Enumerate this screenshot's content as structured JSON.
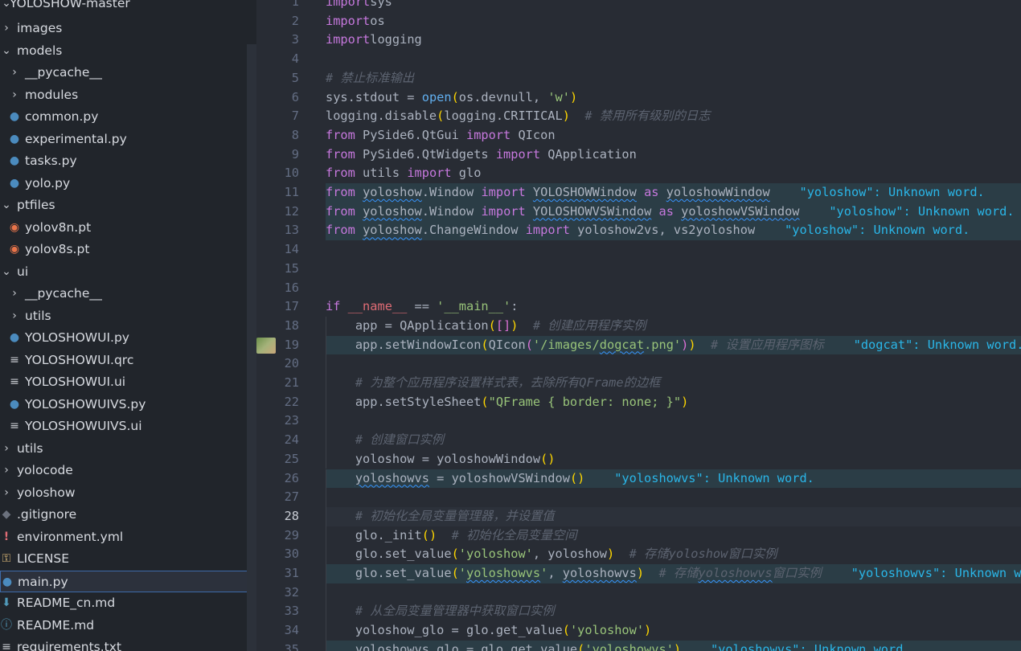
{
  "explorer": {
    "root": "YOLOSHOW-master",
    "items": [
      {
        "label": "images",
        "type": "folder",
        "open": false,
        "depth": 0
      },
      {
        "label": "models",
        "type": "folder",
        "open": true,
        "depth": 0
      },
      {
        "label": "__pycache__",
        "type": "folder",
        "open": false,
        "depth": 1
      },
      {
        "label": "modules",
        "type": "folder",
        "open": false,
        "depth": 1
      },
      {
        "label": "common.py",
        "type": "python",
        "depth": 1
      },
      {
        "label": "experimental.py",
        "type": "python",
        "depth": 1
      },
      {
        "label": "tasks.py",
        "type": "python",
        "depth": 1
      },
      {
        "label": "yolo.py",
        "type": "python",
        "depth": 1
      },
      {
        "label": "ptfiles",
        "type": "folder",
        "open": true,
        "depth": 0
      },
      {
        "label": "yolov8n.pt",
        "type": "rss",
        "depth": 1
      },
      {
        "label": "yolov8s.pt",
        "type": "rss",
        "depth": 1
      },
      {
        "label": "ui",
        "type": "folder",
        "open": true,
        "depth": 0
      },
      {
        "label": "__pycache__",
        "type": "folder",
        "open": false,
        "depth": 1
      },
      {
        "label": "utils",
        "type": "folder",
        "open": false,
        "depth": 1
      },
      {
        "label": "YOLOSHOWUI.py",
        "type": "python",
        "depth": 1
      },
      {
        "label": "YOLOSHOWUI.qrc",
        "type": "text",
        "depth": 1
      },
      {
        "label": "YOLOSHOWUI.ui",
        "type": "text",
        "depth": 1
      },
      {
        "label": "YOLOSHOWUIVS.py",
        "type": "python",
        "depth": 1
      },
      {
        "label": "YOLOSHOWUIVS.ui",
        "type": "text",
        "depth": 1
      },
      {
        "label": "utils",
        "type": "folder",
        "open": false,
        "depth": 0
      },
      {
        "label": "yolocode",
        "type": "folder",
        "open": false,
        "depth": 0
      },
      {
        "label": "yoloshow",
        "type": "folder",
        "open": false,
        "depth": 0
      },
      {
        "label": ".gitignore",
        "type": "git",
        "depth": 0
      },
      {
        "label": "environment.yml",
        "type": "warn",
        "depth": 0
      },
      {
        "label": "LICENSE",
        "type": "license",
        "depth": 0
      },
      {
        "label": "main.py",
        "type": "python",
        "depth": 0,
        "selected": true
      },
      {
        "label": "README_cn.md",
        "type": "md",
        "depth": 0
      },
      {
        "label": "README.md",
        "type": "info",
        "depth": 0
      },
      {
        "label": "requirements.txt",
        "type": "text",
        "depth": 0
      }
    ]
  },
  "editor": {
    "current_line": 28,
    "lines": [
      {
        "n": "1",
        "segs": [
          [
            "k",
            "import"
          ],
          [
            "",
            "sys"
          ]
        ]
      },
      {
        "n": "2",
        "segs": [
          [
            "k",
            "import"
          ],
          [
            "",
            "os"
          ]
        ]
      },
      {
        "n": "3",
        "segs": [
          [
            "k",
            "import"
          ],
          [
            "",
            "logging"
          ]
        ]
      },
      {
        "n": "4",
        "segs": []
      },
      {
        "n": "5",
        "segs": [
          [
            "c",
            "# 禁止标准输出"
          ]
        ]
      },
      {
        "n": "6",
        "segs": [
          [
            "",
            "sys.stdout = "
          ],
          [
            "f",
            "open"
          ],
          [
            "bk1",
            "("
          ],
          [
            "",
            "os.devnull, "
          ],
          [
            "s",
            "'w'"
          ],
          [
            "bk1",
            ")"
          ]
        ]
      },
      {
        "n": "7",
        "segs": [
          [
            "",
            "logging.disable"
          ],
          [
            "bk1",
            "("
          ],
          [
            "",
            "logging.CRITICAL"
          ],
          [
            "bk1",
            ")"
          ],
          [
            "",
            " "
          ],
          [
            "c",
            " # 禁用所有级别的日志"
          ]
        ]
      },
      {
        "n": "8",
        "segs": [
          [
            "k",
            "from"
          ],
          [
            "",
            " PySide6.QtGui "
          ],
          [
            "k",
            "import"
          ],
          [
            "",
            " QIcon"
          ]
        ]
      },
      {
        "n": "9",
        "segs": [
          [
            "k",
            "from"
          ],
          [
            "",
            " PySide6.QtWidgets "
          ],
          [
            "k",
            "import"
          ],
          [
            "",
            " QApplication"
          ]
        ]
      },
      {
        "n": "10",
        "segs": [
          [
            "k",
            "from"
          ],
          [
            "",
            " utils "
          ],
          [
            "k",
            "import"
          ],
          [
            "",
            " glo"
          ]
        ]
      },
      {
        "n": "11",
        "hl": true,
        "segs": [
          [
            "k",
            "from"
          ],
          [
            "",
            " "
          ],
          [
            "w",
            "yoloshow"
          ],
          [
            "",
            ".Window "
          ],
          [
            "k",
            "import"
          ],
          [
            "",
            " "
          ],
          [
            "w",
            "YOLOSHOWWindow"
          ],
          [
            "",
            " "
          ],
          [
            "k",
            "as"
          ],
          [
            "",
            " "
          ],
          [
            "w",
            "yoloshowWindow"
          ],
          [
            "",
            "    "
          ],
          [
            "diag",
            "\"yoloshow\": Unknown word."
          ]
        ]
      },
      {
        "n": "12",
        "hl": true,
        "segs": [
          [
            "k",
            "from"
          ],
          [
            "",
            " "
          ],
          [
            "w",
            "yoloshow"
          ],
          [
            "",
            ".Window "
          ],
          [
            "k",
            "import"
          ],
          [
            "",
            " "
          ],
          [
            "w",
            "YOLOSHOWVSWindow"
          ],
          [
            "",
            " "
          ],
          [
            "k",
            "as"
          ],
          [
            "",
            " "
          ],
          [
            "w",
            "yoloshowVSWindow"
          ],
          [
            "",
            "    "
          ],
          [
            "diag",
            "\"yoloshow\": Unknown word."
          ]
        ]
      },
      {
        "n": "13",
        "hl": true,
        "segs": [
          [
            "k",
            "from"
          ],
          [
            "",
            " "
          ],
          [
            "w",
            "yoloshow"
          ],
          [
            "",
            ".ChangeWindow "
          ],
          [
            "k",
            "import"
          ],
          [
            "",
            " yoloshow2vs, vs2yoloshow"
          ],
          [
            "",
            "    "
          ],
          [
            "diag",
            "\"yoloshow\": Unknown word."
          ]
        ]
      },
      {
        "n": "14",
        "segs": []
      },
      {
        "n": "15",
        "segs": []
      },
      {
        "n": "16",
        "segs": []
      },
      {
        "n": "17",
        "segs": [
          [
            "k",
            "if"
          ],
          [
            "",
            " "
          ],
          [
            "d",
            "__name__"
          ],
          [
            "",
            " == "
          ],
          [
            "s",
            "'__main__'"
          ],
          [
            "",
            ":"
          ]
        ]
      },
      {
        "n": "18",
        "ind": true,
        "segs": [
          [
            "",
            "    app = QApplication"
          ],
          [
            "bk1",
            "("
          ],
          [
            "bk2",
            "[]"
          ],
          [
            "bk1",
            ")"
          ],
          [
            "",
            "  "
          ],
          [
            "c",
            "# 创建应用程序实例"
          ]
        ]
      },
      {
        "n": "19",
        "ind": true,
        "hl": true,
        "glyph": true,
        "segs": [
          [
            "",
            "    app.setWindowIcon"
          ],
          [
            "bk1",
            "("
          ],
          [
            "",
            "QIcon"
          ],
          [
            "bk2",
            "("
          ],
          [
            "s",
            "'/images/"
          ],
          [
            "sw",
            "dogcat"
          ],
          [
            "s",
            ".png'"
          ],
          [
            "bk2",
            ")"
          ],
          [
            "bk1",
            ")"
          ],
          [
            "",
            "  "
          ],
          [
            "c",
            "# 设置应用程序图标"
          ],
          [
            "",
            "    "
          ],
          [
            "diag",
            "\"dogcat\": Unknown word."
          ]
        ]
      },
      {
        "n": "20",
        "ind": true,
        "segs": []
      },
      {
        "n": "21",
        "ind": true,
        "segs": [
          [
            "",
            "    "
          ],
          [
            "c",
            "# 为整个应用程序设置样式表，去除所有QFrame的边框"
          ]
        ]
      },
      {
        "n": "22",
        "ind": true,
        "segs": [
          [
            "",
            "    app.setStyleSheet"
          ],
          [
            "bk1",
            "("
          ],
          [
            "s",
            "\"QFrame { border: none; }\""
          ],
          [
            "bk1",
            ")"
          ]
        ]
      },
      {
        "n": "23",
        "ind": true,
        "segs": []
      },
      {
        "n": "24",
        "ind": true,
        "segs": [
          [
            "",
            "    "
          ],
          [
            "c",
            "# 创建窗口实例"
          ]
        ]
      },
      {
        "n": "25",
        "ind": true,
        "segs": [
          [
            "",
            "    yoloshow = yoloshowWindow"
          ],
          [
            "bk1",
            "()"
          ]
        ]
      },
      {
        "n": "26",
        "ind": true,
        "hl": true,
        "segs": [
          [
            "",
            "    "
          ],
          [
            "w",
            "yoloshowvs"
          ],
          [
            "",
            " = yoloshowVSWindow"
          ],
          [
            "bk1",
            "()"
          ],
          [
            "",
            "    "
          ],
          [
            "diag",
            "\"yoloshowvs\": Unknown word."
          ]
        ]
      },
      {
        "n": "27",
        "ind": true,
        "segs": []
      },
      {
        "n": "28",
        "ind": true,
        "cur": true,
        "segs": [
          [
            "",
            "    "
          ],
          [
            "c",
            "# 初始化全局变量管理器，并设置值"
          ]
        ]
      },
      {
        "n": "29",
        "ind": true,
        "segs": [
          [
            "",
            "    glo._init"
          ],
          [
            "bk1",
            "()"
          ],
          [
            "",
            "  "
          ],
          [
            "c",
            "# 初始化全局变量空间"
          ]
        ]
      },
      {
        "n": "30",
        "ind": true,
        "segs": [
          [
            "",
            "    glo.set_value"
          ],
          [
            "bk1",
            "("
          ],
          [
            "s",
            "'yoloshow'"
          ],
          [
            "",
            ", yoloshow"
          ],
          [
            "bk1",
            ")"
          ],
          [
            "",
            "  "
          ],
          [
            "c",
            "# 存储yoloshow窗口实例"
          ]
        ]
      },
      {
        "n": "31",
        "ind": true,
        "hl": true,
        "segs": [
          [
            "",
            "    glo.set_value"
          ],
          [
            "bk1",
            "("
          ],
          [
            "s",
            "'"
          ],
          [
            "sw",
            "yoloshowvs"
          ],
          [
            "s",
            "'"
          ],
          [
            "",
            ", "
          ],
          [
            "w",
            "yoloshowvs"
          ],
          [
            "bk1",
            ")"
          ],
          [
            "",
            "  "
          ],
          [
            "c",
            "# 存储"
          ],
          [
            "cw",
            "yoloshowvs"
          ],
          [
            "c",
            "窗口实例"
          ],
          [
            "",
            "    "
          ],
          [
            "diag",
            "\"yoloshowvs\": Unknown word."
          ]
        ]
      },
      {
        "n": "32",
        "ind": true,
        "segs": []
      },
      {
        "n": "33",
        "ind": true,
        "segs": [
          [
            "",
            "    "
          ],
          [
            "c",
            "# 从全局变量管理器中获取窗口实例"
          ]
        ]
      },
      {
        "n": "34",
        "ind": true,
        "segs": [
          [
            "",
            "    yoloshow_glo = glo.get_value"
          ],
          [
            "bk1",
            "("
          ],
          [
            "s",
            "'yoloshow'"
          ],
          [
            "bk1",
            ")"
          ]
        ]
      },
      {
        "n": "35",
        "ind": true,
        "hl": true,
        "segs": [
          [
            "",
            "    "
          ],
          [
            "w",
            "yoloshowvs_glo"
          ],
          [
            "",
            " = glo.get_value"
          ],
          [
            "bk1",
            "("
          ],
          [
            "s",
            "'"
          ],
          [
            "sw",
            "yoloshowvs"
          ],
          [
            "s",
            "'"
          ],
          [
            "bk1",
            ")"
          ],
          [
            "",
            "    "
          ],
          [
            "diag",
            "\"yoloshowvs\": Unknown word."
          ]
        ]
      }
    ]
  }
}
